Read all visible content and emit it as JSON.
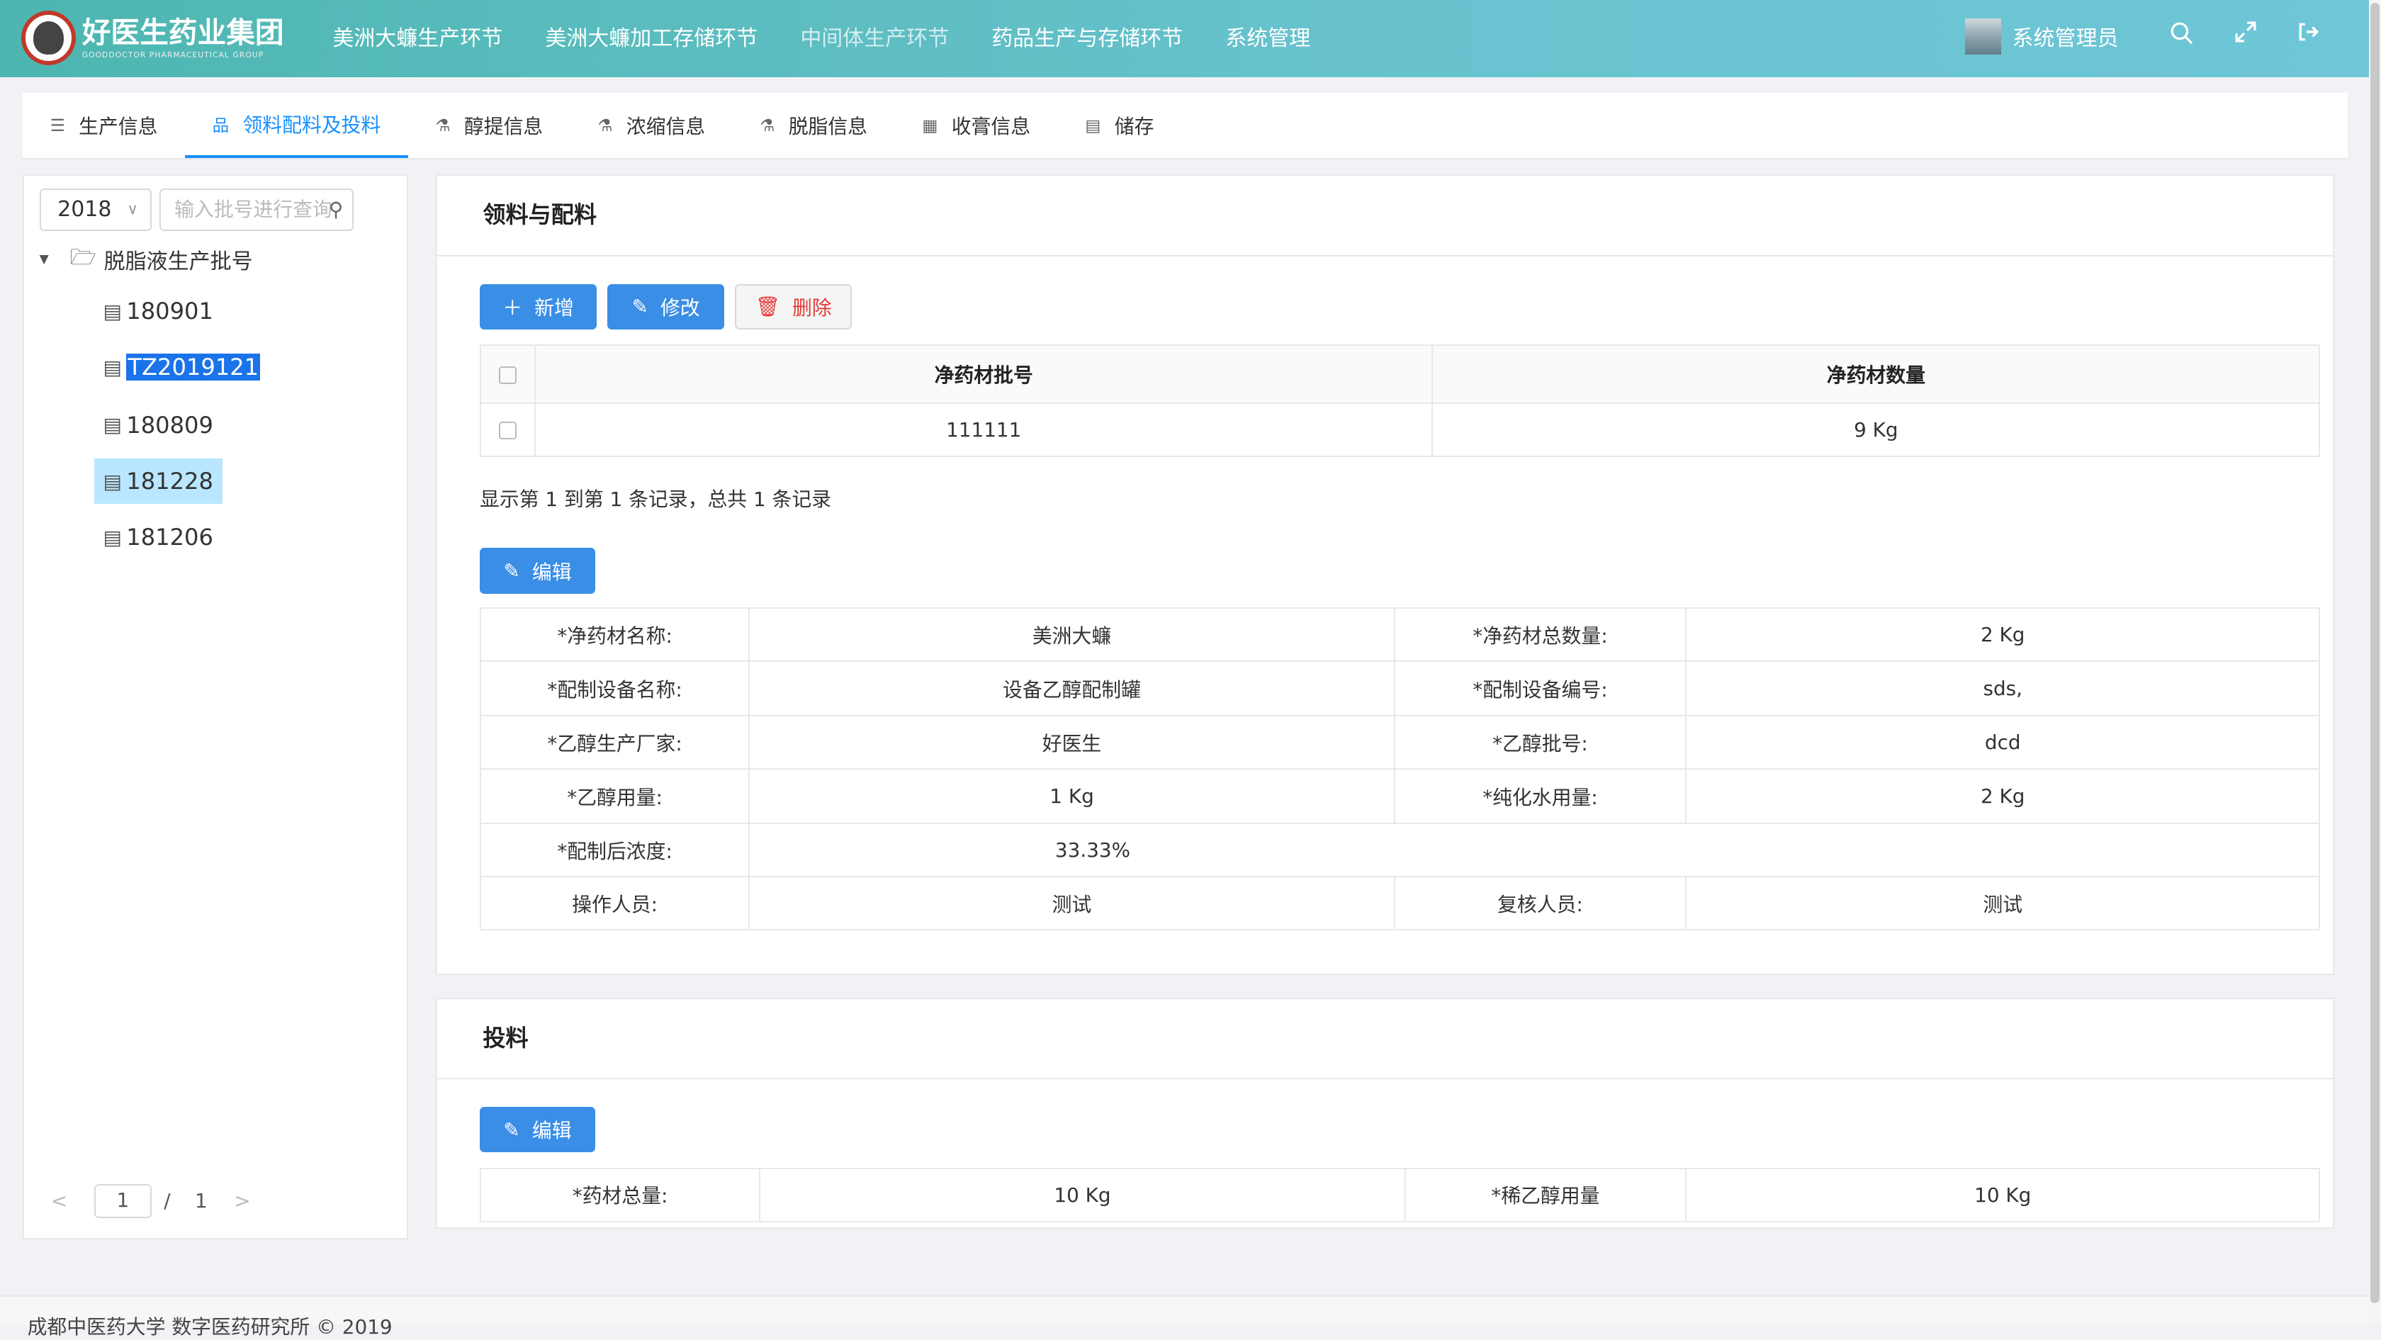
{
  "app": {
    "brand_title": "好医生药业集团",
    "brand_sub": "GOODDOCTOR PHARMACEUTICAL GROUP"
  },
  "nav": {
    "items": [
      "美洲大蠊生产环节",
      "美洲大蠊加工存储环节",
      "中间体生产环节",
      "药品生产与存储环节",
      "系统管理"
    ]
  },
  "user": {
    "name": "系统管理员"
  },
  "header_icons": [
    "search-icon",
    "fullscreen-icon",
    "logout-icon"
  ],
  "tabs": [
    {
      "label": "生产信息",
      "icon": "list-icon"
    },
    {
      "label": "领料配料及投料",
      "icon": "sitemap-icon"
    },
    {
      "label": "醇提信息",
      "icon": "flask-icon"
    },
    {
      "label": "浓缩信息",
      "icon": "flask-icon"
    },
    {
      "label": "脱脂信息",
      "icon": "flask-icon"
    },
    {
      "label": "收膏信息",
      "icon": "building-icon"
    },
    {
      "label": "储存",
      "icon": "storage-icon"
    }
  ],
  "active_tab": "领料配料及投料",
  "left": {
    "year": "2018",
    "search_placeholder": "输入批号进行查询",
    "root": "脱脂液生产批号",
    "nodes": [
      "180901",
      "TZ2019121",
      "180809",
      "181228",
      "181206"
    ],
    "pager": {
      "current": "1",
      "sep": "/",
      "total": "1"
    }
  },
  "section1": {
    "title": "领料与配料",
    "btn_add": "新增",
    "btn_edit": "修改",
    "btn_delete": "删除",
    "table_headers": [
      "净药材批号",
      "净药材数量"
    ],
    "table_rows": [
      [
        "111111",
        "9 Kg"
      ]
    ],
    "records": "显示第 1 到第 1 条记录，总共 1 条记录",
    "btn_edit2": "编辑",
    "details": [
      [
        "*净药材名称:",
        "美洲大蠊",
        "*净药材总数量:",
        "2 Kg"
      ],
      [
        "*配制设备名称:",
        "设备乙醇配制罐",
        "*配制设备编号:",
        "sds,"
      ],
      [
        "*乙醇生产厂家:",
        "好医生",
        "*乙醇批号:",
        "dcd"
      ],
      [
        "*乙醇用量:",
        "1 Kg",
        "*纯化水用量:",
        "2 Kg"
      ],
      [
        "*配制后浓度:",
        "33.33%",
        "",
        ""
      ],
      [
        "操作人员:",
        "测试",
        "复核人员:",
        "测试"
      ]
    ]
  },
  "section2": {
    "title": "投料",
    "btn_edit": "编辑",
    "details": [
      [
        "*药材总量:",
        "10 Kg",
        "*稀乙醇用量",
        "10 Kg"
      ]
    ]
  },
  "footer": {
    "text": "成都中医药大学 数字医药研究所 © 2019"
  }
}
